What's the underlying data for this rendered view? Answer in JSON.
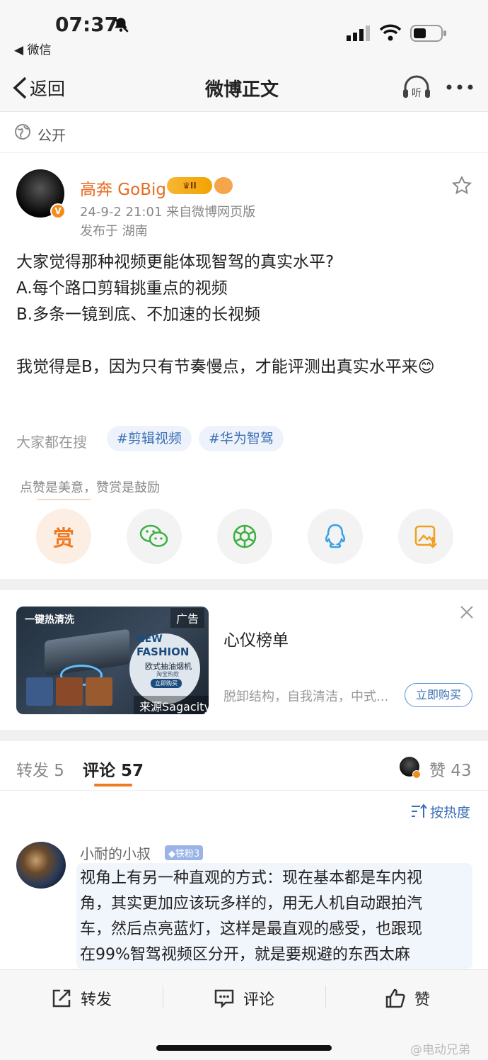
{
  "status": {
    "time": "07:37",
    "back_app": "◀ 微信"
  },
  "nav": {
    "back": "返回",
    "title": "微博正文"
  },
  "visibility": "公开",
  "post": {
    "author": "高奔 GoBig",
    "meta": "24-9-2 21:01 来自微博网页版",
    "location": "发布于 湖南",
    "body": [
      "大家觉得那种视频更能体现智驾的真实水平?",
      "A.每个路口剪辑挑重点的视频",
      "B.多条一镜到底、不加速的长视频",
      "",
      "我觉得是B，因为只有节奏慢点，才能评测出真实水平来😊"
    ],
    "search_label": "大家都在搜",
    "tags": [
      "#剪辑视频",
      "#华为智驾"
    ],
    "reward_hint": "点赞是美意，赞赏是鼓励",
    "reward_icon": "赏",
    "badge_level": "II"
  },
  "ad": {
    "image_title": "一键热清洗",
    "ad_label": "广告",
    "img_text1": "NEW",
    "img_text2": "FASHION",
    "img_text3": "欧式抽油烟机",
    "img_text4": "淘宝热款",
    "img_text5": "立即购买",
    "source": "来源Sagacity",
    "title": "心仪榜单",
    "desc": "脱卸结构，自我清洁，中式...",
    "cta": "立即购买"
  },
  "tabs": {
    "repost": "转发 5",
    "comments": "评论 57",
    "likes": "赞 43",
    "sort": "按热度"
  },
  "comment": {
    "user": "小耐的小叔",
    "badge": "铁粉3",
    "lines": [
      "视角上有另一种直观的方式：现在基本都是车内视",
      "角，其实更加应该玩多样的，用无人机自动跟拍汽",
      "车，然后点亮蓝灯，这样是最直观的感受，也跟现",
      "在99%智驾视频区分开，就是要规避的东西太麻"
    ]
  },
  "bottom": {
    "repost": "转发",
    "comment": "评论",
    "like": "赞"
  },
  "watermark": "@电动兄弟"
}
